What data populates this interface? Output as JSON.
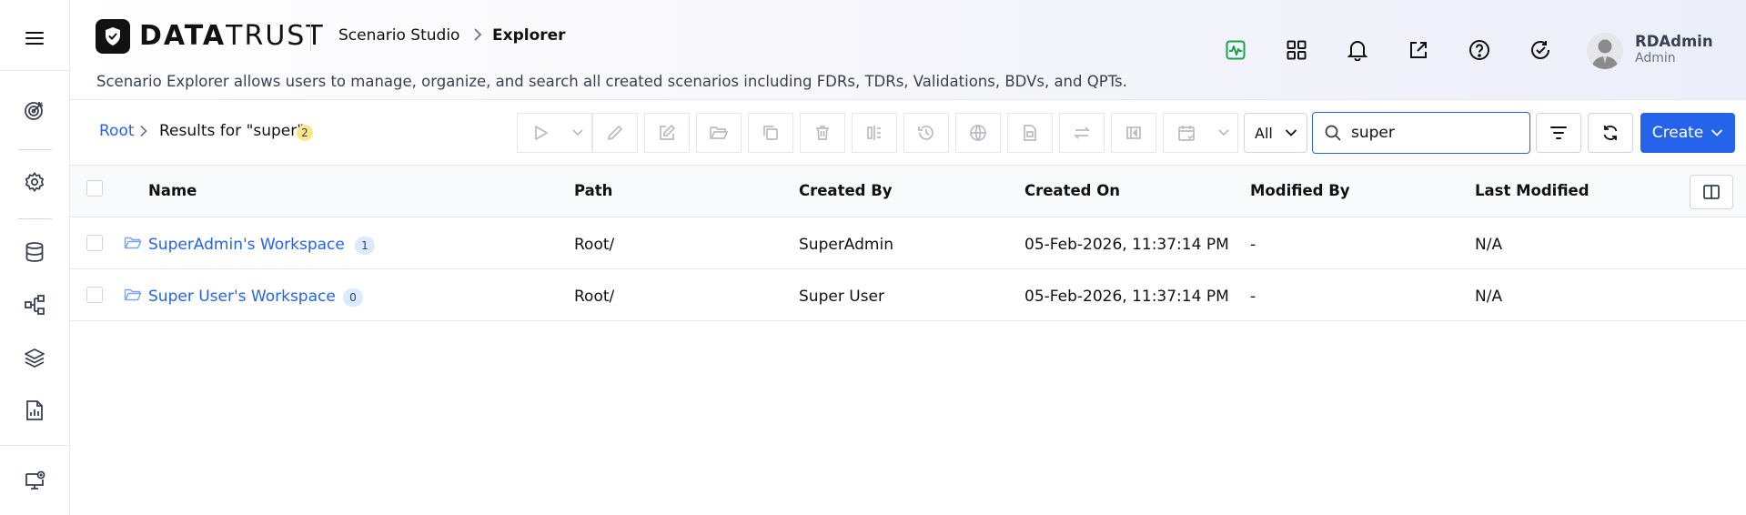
{
  "header": {
    "logo_bold": "DATA",
    "logo_rest": "TRUST",
    "app": "Scenario Studio",
    "page": "Explorer",
    "description": "Scenario Explorer allows users to manage, organize, and search all created scenarios including FDRs, TDRs, Validations, BDVs, and QPTs.",
    "user": {
      "name": "RDAdmin",
      "role": "Admin"
    }
  },
  "toolbar": {
    "root": "Root",
    "results": "Results for \"super\"",
    "results_count": "2",
    "filter_value": "All",
    "search_value": "super",
    "create_label": "Create"
  },
  "table": {
    "columns": [
      "Name",
      "Path",
      "Created By",
      "Created On",
      "Modified By",
      "Last Modified"
    ],
    "rows": [
      {
        "name": "SuperAdmin's Workspace",
        "count": "1",
        "path": "Root/",
        "created_by": "SuperAdmin",
        "created_on": "05-Feb-2026, 11:37:14 PM",
        "modified_by": "-",
        "last_modified": "N/A"
      },
      {
        "name": "Super User's Workspace",
        "count": "0",
        "path": "Root/",
        "created_by": "Super User",
        "created_on": "05-Feb-2026, 11:37:14 PM",
        "modified_by": "-",
        "last_modified": "N/A"
      }
    ]
  },
  "colors": {
    "accent": "#2563eb",
    "pulse_green": "#16a34a",
    "badge_yellow": "#fde68a",
    "badge_blue": "#dbeafe"
  },
  "icons": {
    "rail": [
      "menu-icon",
      "target-icon",
      "gear-icon",
      "database-icon",
      "flow-icon",
      "layers-icon",
      "report-icon",
      "monitor-icon"
    ],
    "header": [
      "activity-icon",
      "apps-grid-icon",
      "bell-icon",
      "external-link-icon",
      "help-icon",
      "check-refresh-icon"
    ],
    "toolbar": [
      "run-icon",
      "pencil-icon",
      "edit-icon",
      "folder-open-icon",
      "copy-icon",
      "trash-icon",
      "compare-icon",
      "history-icon",
      "globe-icon",
      "file-icon",
      "transfer-icon",
      "skip-back-icon",
      "calendar-icon",
      "search-icon",
      "filter-icon",
      "refresh-icon",
      "columns-icon"
    ]
  }
}
